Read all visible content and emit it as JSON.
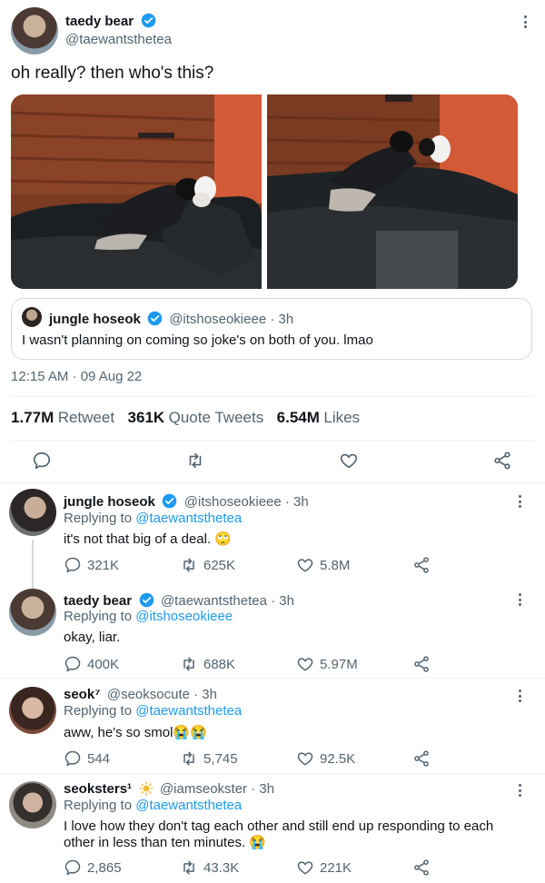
{
  "main_tweet": {
    "name": "taedy bear",
    "handle": "@taewantsthetea",
    "text": "oh really? then who's this?",
    "timestamp": "12:15 AM · 09 Aug 22",
    "stats": {
      "retweets": "1.77M",
      "retweets_label": "Retweet",
      "quotes": "361K",
      "quotes_label": "Quote Tweets",
      "likes": "6.54M",
      "likes_label": "Likes"
    }
  },
  "quoted": {
    "name": "jungle hoseok",
    "handle_time": "@itshoseokieee · 3h",
    "text": "I wasn't planning on coming so joke's on both of you. lmao"
  },
  "replies": [
    {
      "name": "jungle hoseok",
      "handle_time": "@itshoseokieee · 3h",
      "replying_prefix": "Replying to",
      "replying_to": "@taewantsthetea",
      "text": "it's not that big of a deal. 🙄",
      "replies": "321K",
      "retweets": "625K",
      "likes": "5.8M"
    },
    {
      "name": "taedy bear",
      "handle_time": "@taewantsthetea · 3h",
      "replying_prefix": "Replying to",
      "replying_to": "@itshoseokieee",
      "text": "okay, liar.",
      "replies": "400K",
      "retweets": "688K",
      "likes": "5.97M"
    },
    {
      "name": "seok⁷",
      "handle_time": "@seoksocute · 3h",
      "replying_prefix": "Replying to",
      "replying_to": "@taewantsthetea",
      "text": "aww, he's so smol😭😭",
      "replies": "544",
      "retweets": "5,745",
      "likes": "92.5K"
    },
    {
      "name": "seoksters¹",
      "handle_time": "@iamseokster · 3h",
      "replying_prefix": "Replying to",
      "replying_to": "@taewantsthetea",
      "text": "I love how they don't tag each other and still end up responding to each other in less than ten minutes. 😭",
      "replies": "2,865",
      "retweets": "43.3K",
      "likes": "221K"
    }
  ],
  "colors": {
    "accent": "#1d9bf0",
    "text": "#0f1419",
    "muted": "#536471",
    "divider": "#eff3f4"
  }
}
